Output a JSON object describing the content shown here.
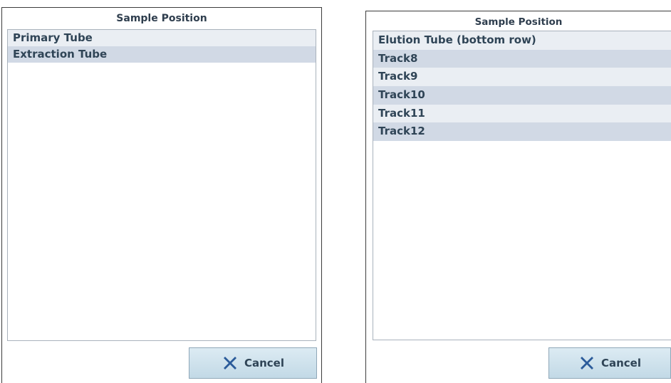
{
  "left_dialog": {
    "title": "Sample Position",
    "items": [
      {
        "label": "Primary Tube"
      },
      {
        "label": "Extraction Tube"
      }
    ],
    "cancel_label": "Cancel"
  },
  "right_dialog": {
    "title": "Sample Position",
    "items": [
      {
        "label": "Elution Tube (bottom row)"
      },
      {
        "label": "Track8"
      },
      {
        "label": "Track9"
      },
      {
        "label": "Track10"
      },
      {
        "label": "Track11"
      },
      {
        "label": "Track12"
      }
    ],
    "cancel_label": "Cancel"
  },
  "icons": {
    "cancel": "close-x-icon"
  },
  "colors": {
    "row_light": "#eaeef3",
    "row_dark": "#d1d9e5",
    "text": "#2f4456",
    "icon_blue": "#2b5b9a"
  }
}
